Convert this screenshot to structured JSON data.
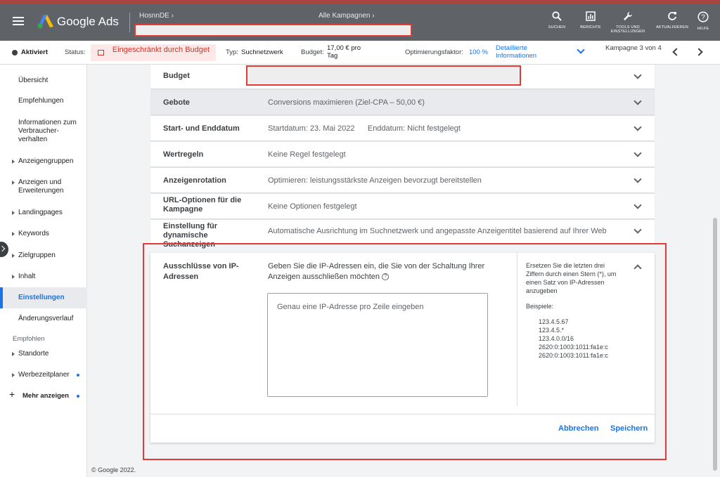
{
  "header": {
    "brand": "Google Ads",
    "breadcrumb_account": "HosnnDE",
    "breadcrumb_campaigns": "Alle Kampagnen",
    "tools": [
      {
        "icon": "search-icon",
        "label": "SUCHEN"
      },
      {
        "icon": "reports-icon",
        "label": "BERICHTE"
      },
      {
        "icon": "wrench-icon",
        "label": "TOOLS UND EINSTELLUNGEN"
      },
      {
        "icon": "refresh-icon",
        "label": "AKTUALISIEREN"
      },
      {
        "icon": "help-icon",
        "label": "HILFE"
      }
    ]
  },
  "statusbar": {
    "state": "Aktiviert",
    "status_label": "Status:",
    "status_value": "Eingeschränkt durch Budget",
    "type_label": "Typ:",
    "type_value": "Suchnetzwerk",
    "budget_label": "Budget:",
    "budget_value": "17,00 € pro Tag",
    "opt_label": "Optimierungsfaktor:",
    "opt_value": "100 %",
    "details_link": "Detaillierte Informationen",
    "campaign_pos": "Kampagne 3 von 4"
  },
  "sidebar": {
    "items": [
      {
        "label": "Übersicht",
        "arrow": false
      },
      {
        "label": "Empfehlungen",
        "arrow": false
      },
      {
        "label": "Informationen zum Verbraucher-verhalten",
        "arrow": false
      },
      {
        "label": "Anzeigengruppen",
        "arrow": true
      },
      {
        "label": "Anzeigen und Erweiterungen",
        "arrow": true
      },
      {
        "label": "Landingpages",
        "arrow": true
      },
      {
        "label": "Keywords",
        "arrow": true
      },
      {
        "label": "Zielgruppen",
        "arrow": true
      },
      {
        "label": "Inhalt",
        "arrow": true
      },
      {
        "label": "Einstellungen",
        "arrow": false,
        "active": true
      },
      {
        "label": "Änderungsverlauf",
        "arrow": false
      }
    ],
    "section_label": "Empfohlen",
    "recommended": [
      {
        "label": "Standorte",
        "arrow": true
      },
      {
        "label": "Werbezeitplaner",
        "arrow": true,
        "dot": true
      }
    ],
    "more": "Mehr anzeigen"
  },
  "settings_rows": [
    {
      "label": "Budget",
      "value": ""
    },
    {
      "label": "Gebote",
      "value": "Conversions maximieren (Ziel-CPA – 50,00 €)"
    },
    {
      "label": "Start- und Enddatum",
      "value": "Startdatum: 23. Mai 2022      Enddatum: Nicht festgelegt"
    },
    {
      "label": "Wertregeln",
      "value": "Keine Regel festgelegt"
    },
    {
      "label": "Anzeigenrotation",
      "value": "Optimieren: leistungsstärkste Anzeigen bevorzugt bereitstellen"
    },
    {
      "label": "URL-Optionen für die Kampagne",
      "value": "Keine Optionen festgelegt"
    },
    {
      "label": "Einstellung für dynamische Suchanzeigen",
      "value": "Automatische Ausrichtung im Suchnetzwerk und angepasste Anzeigentitel basierend auf Ihrer Web"
    }
  ],
  "ip_card": {
    "title": "Ausschlüsse von IP-Adressen",
    "description": "Geben Sie die IP-Adressen ein, die Sie von der Schaltung Ihrer Anzeigen ausschließen möchten",
    "placeholder": "Genau eine IP-Adresse pro Zeile eingeben",
    "help_text": "Ersetzen Sie die letzten drei Ziffern durch einen Stern (*), um einen Satz von IP-Adressen anzugeben",
    "examples_label": "Beispiele:",
    "examples": [
      "123.4.5.67",
      "123.4.5.*",
      "123.4.0.0/16",
      "2620:0:1003:1011:fa1e:c",
      "2620:0:1003:1011:fa1e:c"
    ],
    "cancel": "Abbrechen",
    "save": "Speichern"
  },
  "footer": "© Google 2022.",
  "colors": {
    "accent": "#1a73e8",
    "header": "#5f6368",
    "error": "#d93025",
    "highlight": "#e53935"
  }
}
